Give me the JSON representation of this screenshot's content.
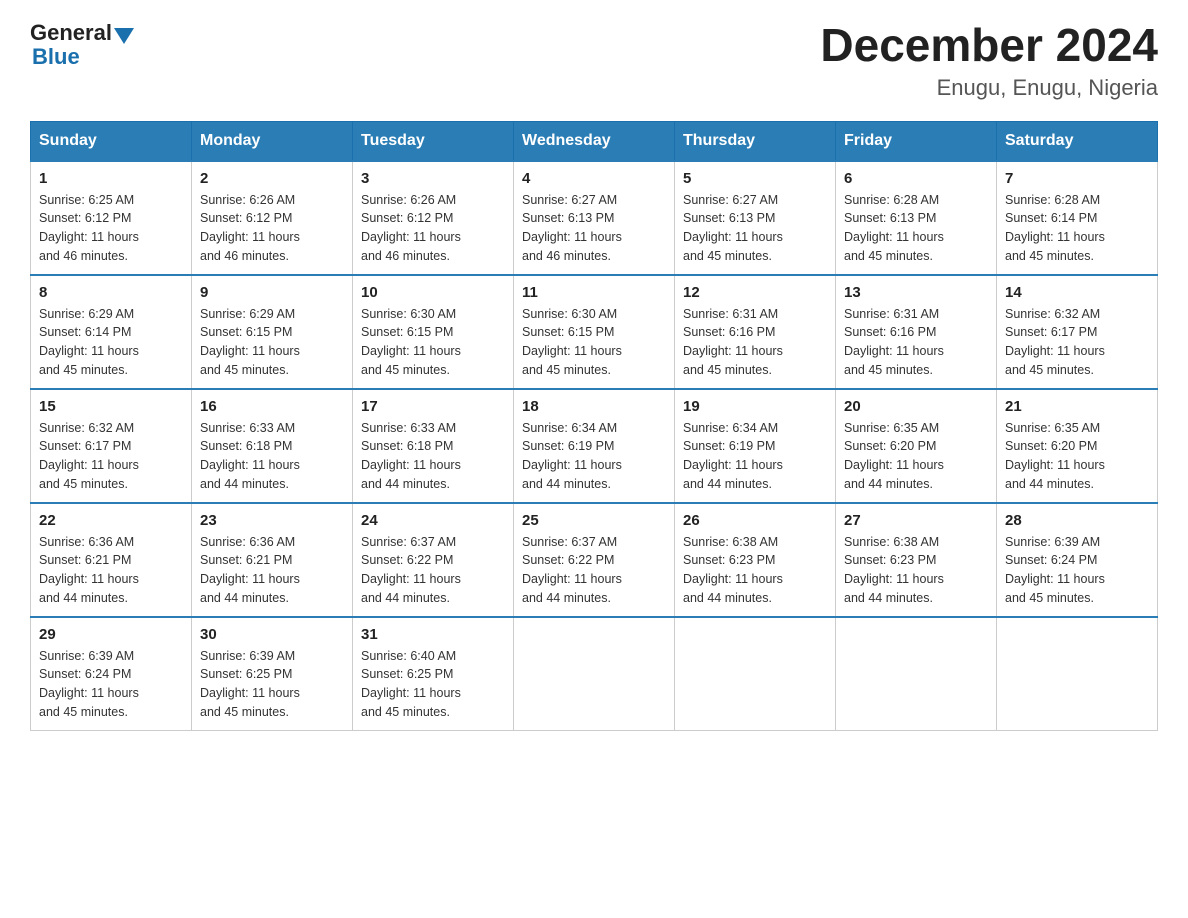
{
  "header": {
    "title": "December 2024",
    "location": "Enugu, Enugu, Nigeria",
    "logo_general": "General",
    "logo_blue": "Blue"
  },
  "columns": [
    "Sunday",
    "Monday",
    "Tuesday",
    "Wednesday",
    "Thursday",
    "Friday",
    "Saturday"
  ],
  "weeks": [
    [
      {
        "day": "1",
        "sunrise": "6:25 AM",
        "sunset": "6:12 PM",
        "daylight": "11 hours and 46 minutes."
      },
      {
        "day": "2",
        "sunrise": "6:26 AM",
        "sunset": "6:12 PM",
        "daylight": "11 hours and 46 minutes."
      },
      {
        "day": "3",
        "sunrise": "6:26 AM",
        "sunset": "6:12 PM",
        "daylight": "11 hours and 46 minutes."
      },
      {
        "day": "4",
        "sunrise": "6:27 AM",
        "sunset": "6:13 PM",
        "daylight": "11 hours and 46 minutes."
      },
      {
        "day": "5",
        "sunrise": "6:27 AM",
        "sunset": "6:13 PM",
        "daylight": "11 hours and 45 minutes."
      },
      {
        "day": "6",
        "sunrise": "6:28 AM",
        "sunset": "6:13 PM",
        "daylight": "11 hours and 45 minutes."
      },
      {
        "day": "7",
        "sunrise": "6:28 AM",
        "sunset": "6:14 PM",
        "daylight": "11 hours and 45 minutes."
      }
    ],
    [
      {
        "day": "8",
        "sunrise": "6:29 AM",
        "sunset": "6:14 PM",
        "daylight": "11 hours and 45 minutes."
      },
      {
        "day": "9",
        "sunrise": "6:29 AM",
        "sunset": "6:15 PM",
        "daylight": "11 hours and 45 minutes."
      },
      {
        "day": "10",
        "sunrise": "6:30 AM",
        "sunset": "6:15 PM",
        "daylight": "11 hours and 45 minutes."
      },
      {
        "day": "11",
        "sunrise": "6:30 AM",
        "sunset": "6:15 PM",
        "daylight": "11 hours and 45 minutes."
      },
      {
        "day": "12",
        "sunrise": "6:31 AM",
        "sunset": "6:16 PM",
        "daylight": "11 hours and 45 minutes."
      },
      {
        "day": "13",
        "sunrise": "6:31 AM",
        "sunset": "6:16 PM",
        "daylight": "11 hours and 45 minutes."
      },
      {
        "day": "14",
        "sunrise": "6:32 AM",
        "sunset": "6:17 PM",
        "daylight": "11 hours and 45 minutes."
      }
    ],
    [
      {
        "day": "15",
        "sunrise": "6:32 AM",
        "sunset": "6:17 PM",
        "daylight": "11 hours and 45 minutes."
      },
      {
        "day": "16",
        "sunrise": "6:33 AM",
        "sunset": "6:18 PM",
        "daylight": "11 hours and 44 minutes."
      },
      {
        "day": "17",
        "sunrise": "6:33 AM",
        "sunset": "6:18 PM",
        "daylight": "11 hours and 44 minutes."
      },
      {
        "day": "18",
        "sunrise": "6:34 AM",
        "sunset": "6:19 PM",
        "daylight": "11 hours and 44 minutes."
      },
      {
        "day": "19",
        "sunrise": "6:34 AM",
        "sunset": "6:19 PM",
        "daylight": "11 hours and 44 minutes."
      },
      {
        "day": "20",
        "sunrise": "6:35 AM",
        "sunset": "6:20 PM",
        "daylight": "11 hours and 44 minutes."
      },
      {
        "day": "21",
        "sunrise": "6:35 AM",
        "sunset": "6:20 PM",
        "daylight": "11 hours and 44 minutes."
      }
    ],
    [
      {
        "day": "22",
        "sunrise": "6:36 AM",
        "sunset": "6:21 PM",
        "daylight": "11 hours and 44 minutes."
      },
      {
        "day": "23",
        "sunrise": "6:36 AM",
        "sunset": "6:21 PM",
        "daylight": "11 hours and 44 minutes."
      },
      {
        "day": "24",
        "sunrise": "6:37 AM",
        "sunset": "6:22 PM",
        "daylight": "11 hours and 44 minutes."
      },
      {
        "day": "25",
        "sunrise": "6:37 AM",
        "sunset": "6:22 PM",
        "daylight": "11 hours and 44 minutes."
      },
      {
        "day": "26",
        "sunrise": "6:38 AM",
        "sunset": "6:23 PM",
        "daylight": "11 hours and 44 minutes."
      },
      {
        "day": "27",
        "sunrise": "6:38 AM",
        "sunset": "6:23 PM",
        "daylight": "11 hours and 44 minutes."
      },
      {
        "day": "28",
        "sunrise": "6:39 AM",
        "sunset": "6:24 PM",
        "daylight": "11 hours and 45 minutes."
      }
    ],
    [
      {
        "day": "29",
        "sunrise": "6:39 AM",
        "sunset": "6:24 PM",
        "daylight": "11 hours and 45 minutes."
      },
      {
        "day": "30",
        "sunrise": "6:39 AM",
        "sunset": "6:25 PM",
        "daylight": "11 hours and 45 minutes."
      },
      {
        "day": "31",
        "sunrise": "6:40 AM",
        "sunset": "6:25 PM",
        "daylight": "11 hours and 45 minutes."
      },
      null,
      null,
      null,
      null
    ]
  ],
  "labels": {
    "sunrise": "Sunrise:",
    "sunset": "Sunset:",
    "daylight": "Daylight:"
  }
}
